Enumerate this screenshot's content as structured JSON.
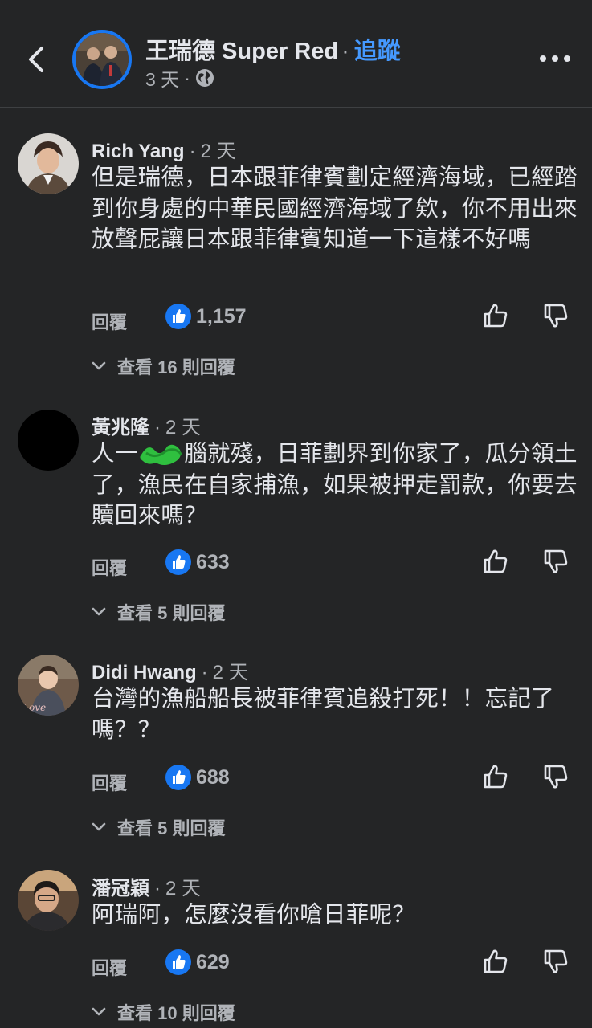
{
  "header": {
    "page_name": "王瑞德 Super Red",
    "separator": "·",
    "follow_label": "追蹤",
    "post_time": "3 天",
    "dot": "·",
    "back_icon": "chevron-left-icon",
    "privacy_icon": "globe-icon",
    "more_icon": "more-horizontal-icon"
  },
  "colors": {
    "background": "#242526",
    "text": "#e4e6eb",
    "secondary_text": "#b0b3b8",
    "accent": "#1877f2",
    "follow": "#4599ff"
  },
  "comments": [
    {
      "name": "Rich Yang",
      "dot": "·",
      "time": "2 天",
      "text": "但是瑞德，日本跟菲律賓劃定經濟海域，已經踏到你身處的中華民國經濟海域了欸，你不用出來放聲屁讓日本跟菲律賓知道一下這樣不好嗎",
      "reply_label": "回覆",
      "likes": "1,157",
      "view_replies": "查看 16 則回覆"
    },
    {
      "name": "黃兆隆",
      "dot": "·",
      "time": "2 天",
      "text": "人一　　腦就殘，日菲劃界到你家了，瓜分領土了，漁民在自家捕漁，如果被押走罰款，你要去贖回來嗎？",
      "reply_label": "回覆",
      "likes": "633",
      "view_replies": "查看 5 則回覆"
    },
    {
      "name": "Didi Hwang",
      "dot": "·",
      "time": "2 天",
      "text": "台灣的漁船船長被菲律賓追殺打死！！忘記了嗎？？",
      "reply_label": "回覆",
      "likes": "688",
      "view_replies": "查看 5 則回覆"
    },
    {
      "name": "潘冠穎",
      "dot": "·",
      "time": "2 天",
      "text": "阿瑞阿，怎麼沒看你嗆日菲呢？",
      "reply_label": "回覆",
      "likes": "629",
      "view_replies": "查看 10 則回覆"
    }
  ]
}
